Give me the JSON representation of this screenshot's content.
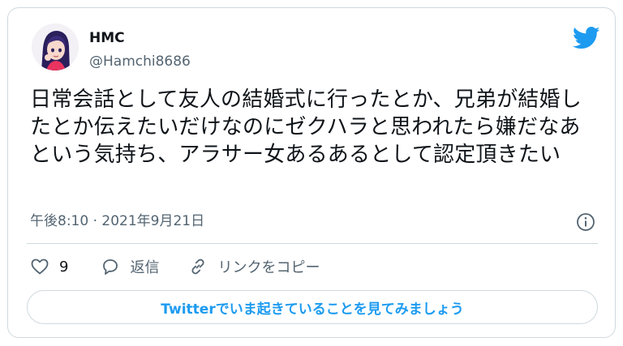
{
  "user": {
    "display_name": "HMC",
    "handle": "@Hamchi8686",
    "avatar_icon": "anime-avatar"
  },
  "tweet": {
    "text": "日常会話として友人の結婚式に行ったとか、兄弟が結婚したとか伝えたいだけなのにゼクハラと思われたら嫌だなあという気持ち、アラサー女あるあるとして認定頂きたい",
    "timestamp": "午後8:10 · 2021年9月21日"
  },
  "actions": {
    "like_count": "9",
    "reply_label": "返信",
    "copy_link_label": "リンクをコピー"
  },
  "cta": {
    "label": "Twitterでいま起きていることを見てみましょう"
  },
  "colors": {
    "accent": "#1d9bf0",
    "text": "#0f1419",
    "muted": "#536471",
    "border": "#cfd9de"
  },
  "icons": [
    "twitter-bird-icon",
    "info-icon",
    "heart-icon",
    "reply-icon",
    "link-icon"
  ]
}
